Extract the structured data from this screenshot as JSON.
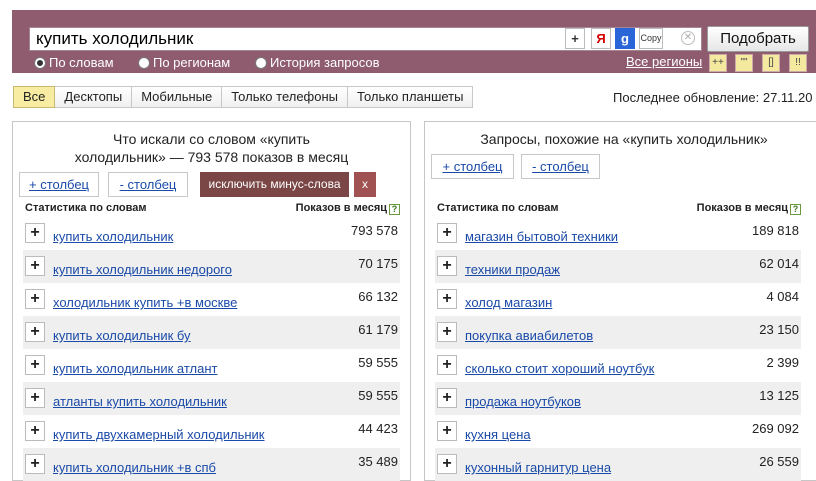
{
  "search": {
    "query": "купить холодильник",
    "kb_plus": "+",
    "kb_ya": "Я",
    "kb_g": "g",
    "kb_copy": "Copy",
    "clear_icon": "close-icon",
    "submit_label": "Подобрать"
  },
  "modes": {
    "by_words": "По словам",
    "by_regions": "По регионам",
    "history": "История запросов",
    "selected": "По словам"
  },
  "regions_link": "Все регионы",
  "mini_buttons": [
    "++",
    "\"\"",
    "[]",
    "!!"
  ],
  "device_tabs": [
    "Все",
    "Десктопы",
    "Мобильные",
    "Только телефоны",
    "Только планшеты"
  ],
  "active_tab": "Все",
  "last_update": "Последнее обновление: 27.11.20",
  "left_panel": {
    "title_line1": "Что искали со словом «купить",
    "title_line2": "холодильник» — 793 578 показов в месяц",
    "add_column": "+ столбец",
    "remove_column": "- столбец",
    "exclude_minus": "исключить минус-слова",
    "close": "x",
    "col_stat": "Статистика по словам",
    "col_impr": "Показов в месяц",
    "help": "?",
    "rows": [
      {
        "phrase": "купить холодильник",
        "count": "793 578"
      },
      {
        "phrase": "купить холодильник недорого",
        "count": "70 175"
      },
      {
        "phrase": "холодильник купить +в москве",
        "count": "66 132"
      },
      {
        "phrase": "купить холодильник бу",
        "count": "61 179"
      },
      {
        "phrase": "купить холодильник атлант",
        "count": "59 555"
      },
      {
        "phrase": "атланты купить холодильник",
        "count": "59 555"
      },
      {
        "phrase": "купить двухкамерный холодильник",
        "count": "44 423"
      },
      {
        "phrase": "купить холодильник +в спб",
        "count": "35 489"
      }
    ]
  },
  "right_panel": {
    "title": "Запросы, похожие на «купить холодильник»",
    "add_column": "+ столбец",
    "remove_column": "- столбец",
    "col_stat": "Статистика по словам",
    "col_impr": "Показов в месяц",
    "help": "?",
    "rows": [
      {
        "phrase": "магазин бытовой техники",
        "count": "189 818"
      },
      {
        "phrase": "техники продаж",
        "count": "62 014"
      },
      {
        "phrase": "холод магазин",
        "count": "4 084"
      },
      {
        "phrase": "покупка авиабилетов",
        "count": "23 150"
      },
      {
        "phrase": "сколько стоит хороший ноутбук",
        "count": "2 399"
      },
      {
        "phrase": "продажа ноутбуков",
        "count": "13 125"
      },
      {
        "phrase": "кухня цена",
        "count": "269 092"
      },
      {
        "phrase": "кухонный гарнитур цена",
        "count": "26 559"
      }
    ]
  }
}
